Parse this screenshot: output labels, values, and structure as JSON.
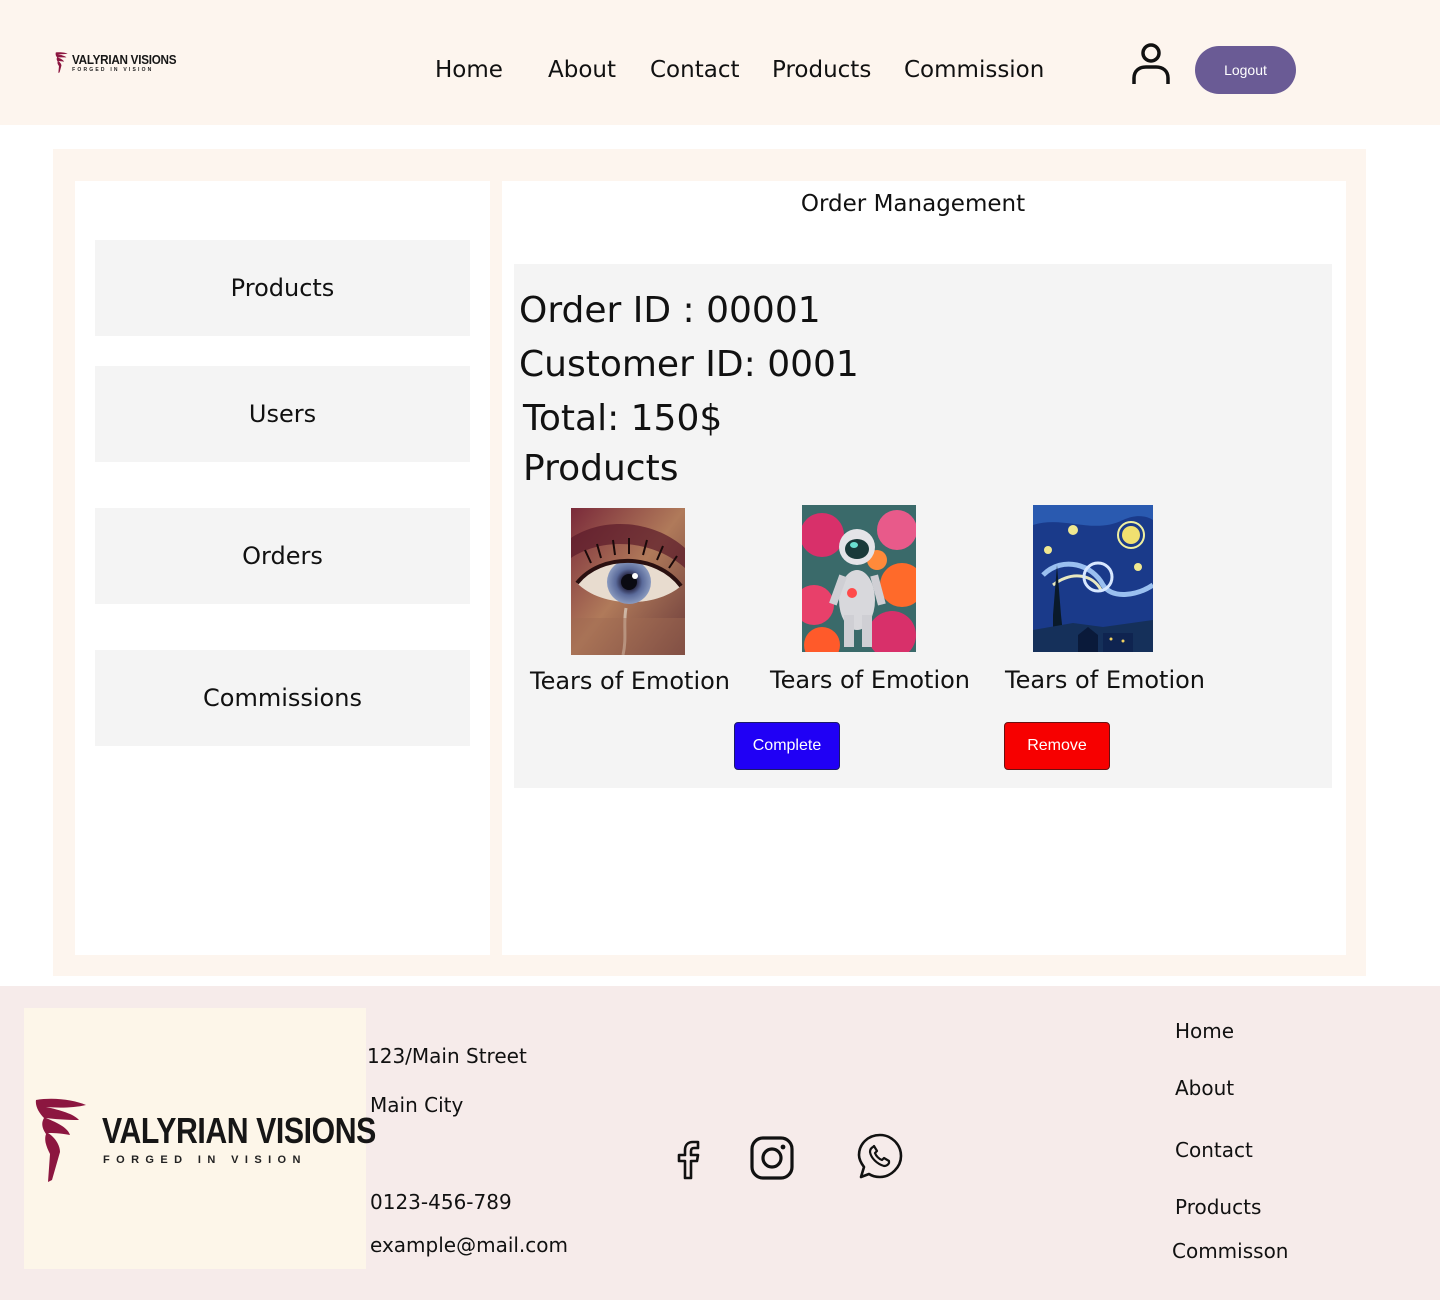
{
  "brand": {
    "name": "VALYRIAN VISIONS",
    "tagline": "FORGED IN VISION",
    "accent_color": "#8c1640"
  },
  "header": {
    "nav": [
      "Home",
      "About",
      "Contact",
      "Products",
      "Commission"
    ],
    "user_icon": "user-icon",
    "logout_label": "Logout",
    "logout_color": "#6a5b95"
  },
  "sidebar": {
    "items": [
      "Products",
      "Users",
      "Orders",
      "Commissions"
    ]
  },
  "main": {
    "title": "Order Management",
    "order": {
      "order_id_line": "Order ID : 00001",
      "customer_id_line": "Customer ID: 0001",
      "total_line": "Total: 150$",
      "products_heading": "Products",
      "products": [
        {
          "name": "Tears of Emotion",
          "image": "eye-painting"
        },
        {
          "name": "Tears of Emotion",
          "image": "astronaut-flowers-painting"
        },
        {
          "name": "Tears of Emotion",
          "image": "starry-night-painting"
        }
      ],
      "complete_label": "Complete",
      "complete_color": "#2000f5",
      "remove_label": "Remove",
      "remove_color": "#f70000"
    }
  },
  "footer": {
    "address_line1": "123/Main Street",
    "address_line2": "Main City",
    "phone": "0123-456-789",
    "email": "example@mail.com",
    "social_icons": [
      "facebook-icon",
      "instagram-icon",
      "whatsapp-icon"
    ],
    "links": [
      "Home",
      "About",
      "Contact",
      "Products",
      "Commisson"
    ]
  }
}
